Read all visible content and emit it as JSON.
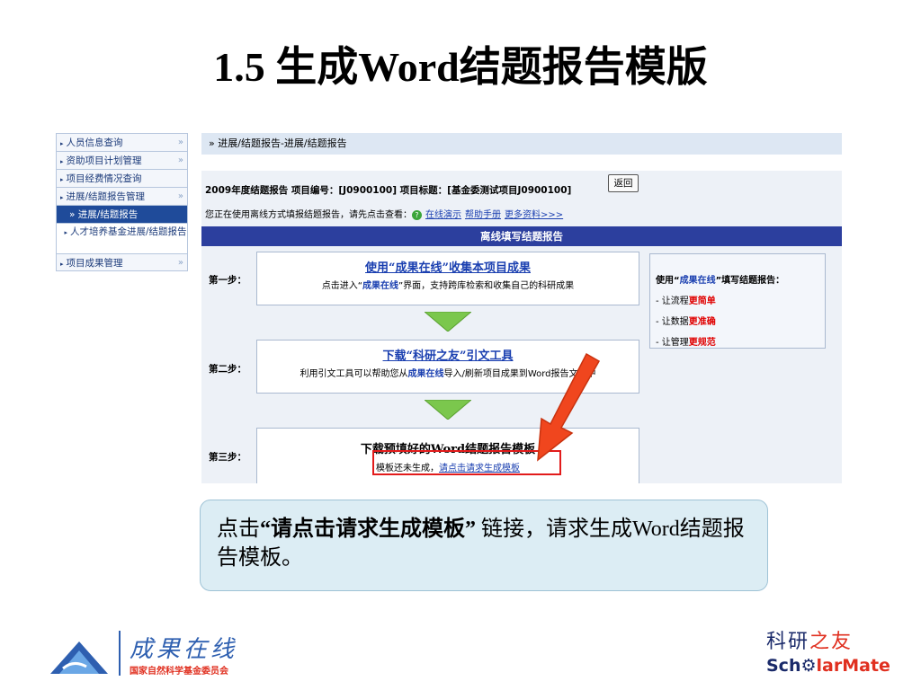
{
  "slide": {
    "title": "1.5 生成Word结题报告模版",
    "callout": {
      "prefix": "点击",
      "bold": "“请点击请求生成模板”",
      "suffix": " 链接，请求生成Word结题报告模板。"
    }
  },
  "sidebar": {
    "items": [
      {
        "label": "人员信息查询",
        "arrow": "»"
      },
      {
        "label": "资助项目计划管理",
        "arrow": "»"
      },
      {
        "label": "项目经费情况查询",
        "arrow": ""
      },
      {
        "label": "进展/结题报告管理",
        "arrow": "»"
      },
      {
        "label": "进展/结题报告",
        "arrow": ""
      },
      {
        "label": "人才培养基金进展/结题报告",
        "arrow": ""
      },
      {
        "label": "项目成果管理",
        "arrow": "»"
      }
    ]
  },
  "breadcrumb": {
    "marker": "»",
    "text": "进展/结题报告-进展/结题报告"
  },
  "info": {
    "report_line": "2009年度结题报告  项目编号：[J0900100]  项目标题：[基金委测试项目J0900100]",
    "back_button": "返回",
    "offline_text": "您正在使用离线方式填报结题报告，请先点击查看：",
    "links": [
      "在线演示",
      "帮助手册",
      "更多资料>>>"
    ]
  },
  "panel": {
    "header": "离线填写结题报告",
    "steps": [
      {
        "label": "第一步：",
        "title": "使用“成果在线”收集本项目成果",
        "desc_prefix": "点击进入“",
        "desc_hl": "成果在线",
        "desc_suffix": "”界面，支持跨库检索和收集自己的科研成果"
      },
      {
        "label": "第二步：",
        "title": "下载“科研之友”引文工具",
        "desc_prefix": "利用引文工具可以帮助您从",
        "desc_hl": "成果在线",
        "desc_suffix": "导入/刷新项目成果到Word报告文件中"
      },
      {
        "label": "第三步：",
        "title": "下载预填好的Word结题报告模板",
        "desc_prefix": "模板还未生成，",
        "desc_link": "请点击请求生成模板"
      }
    ],
    "benefits": {
      "title_prefix": "使用“",
      "title_hl": "成果在线",
      "title_suffix": "”填写结题报告：",
      "items": [
        {
          "prefix": "- 让流程",
          "hl": "更简单"
        },
        {
          "prefix": "- 让数据",
          "hl": "更准确"
        },
        {
          "prefix": "- 让管理",
          "hl": "更规范"
        }
      ]
    }
  },
  "logos": {
    "left_title": "成果在线",
    "left_sub": "国家自然科学基金委员会",
    "right_top_a": "科研",
    "right_top_b": "之友",
    "right_bottom_a": "Sch",
    "right_bottom_b": "larMate"
  },
  "colors": {
    "accent": "#2c3f9e",
    "highlight": "#e21b1b",
    "link": "#1a3fb0",
    "callout_bg": "#dcedf4"
  }
}
